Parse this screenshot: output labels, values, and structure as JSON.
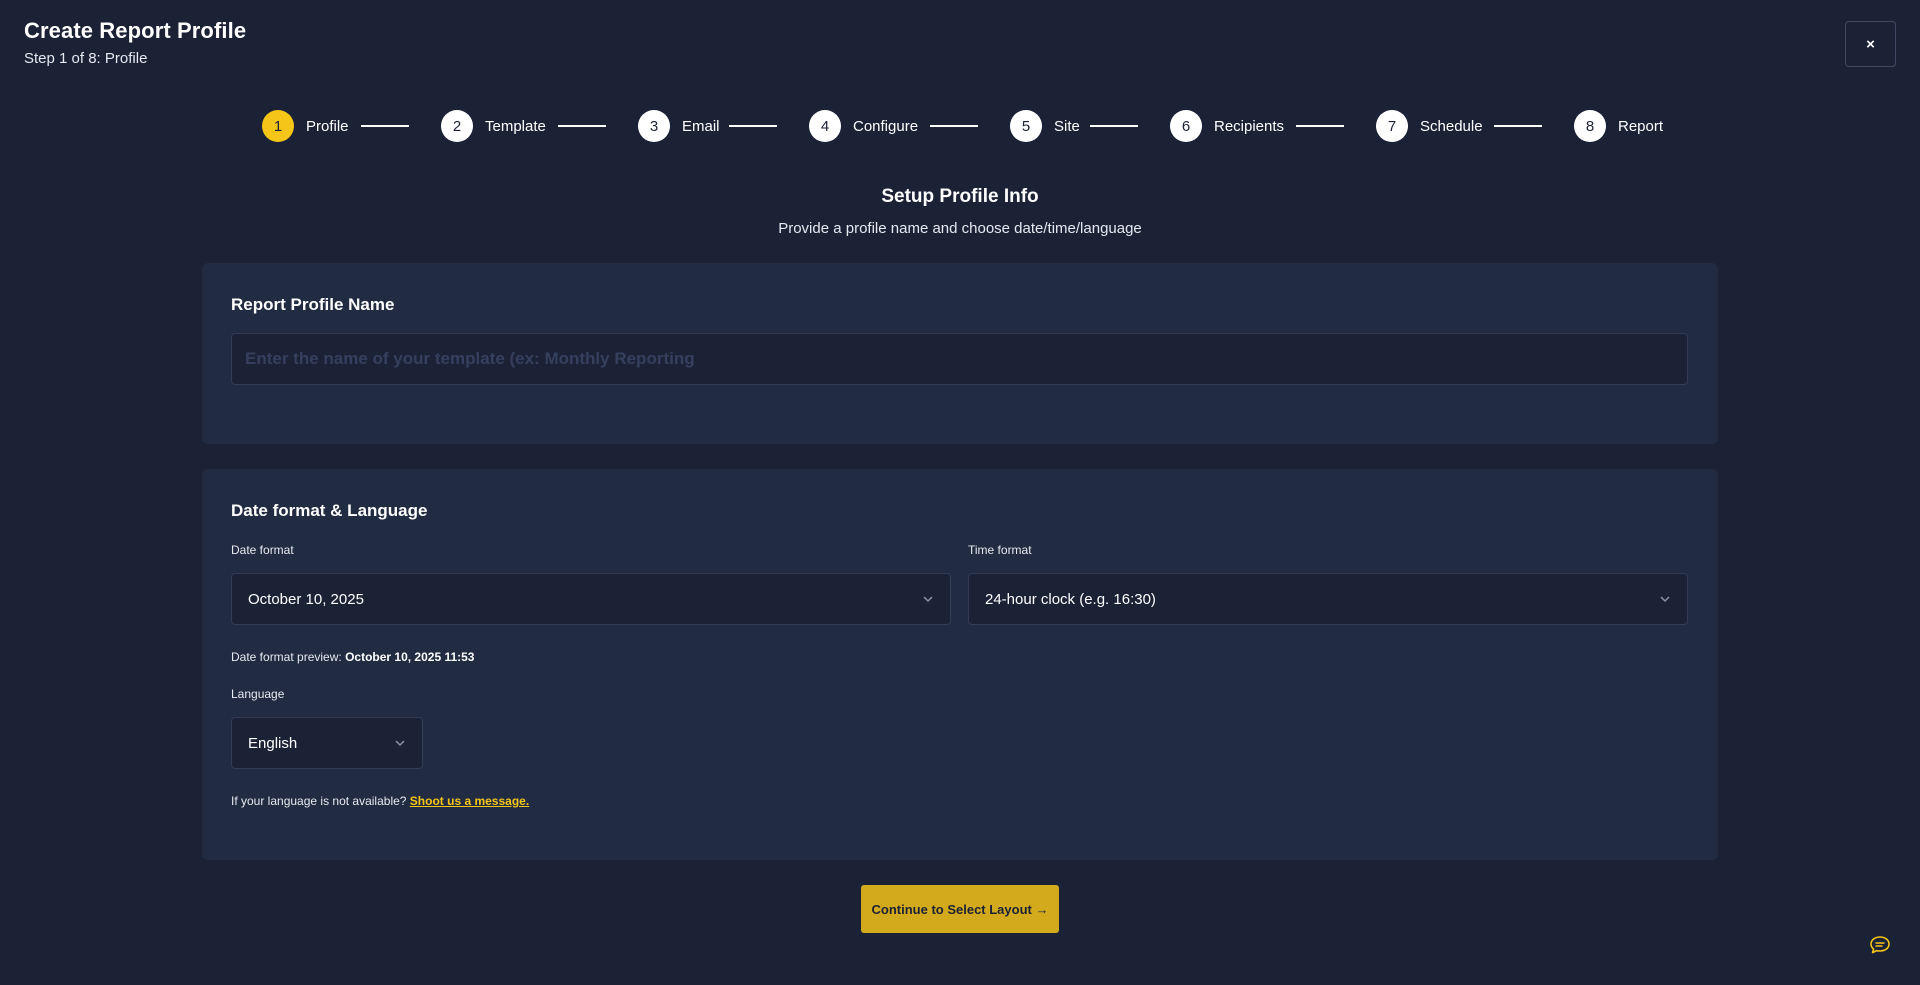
{
  "header": {
    "title": "Create Report Profile",
    "subtitle": "Step 1 of 8: Profile",
    "close_label": "×"
  },
  "stepper": {
    "steps": [
      {
        "number": "1",
        "label": "Profile",
        "active": true
      },
      {
        "number": "2",
        "label": "Template",
        "active": false
      },
      {
        "number": "3",
        "label": "Email",
        "active": false
      },
      {
        "number": "4",
        "label": "Configure",
        "active": false
      },
      {
        "number": "5",
        "label": "Site",
        "active": false
      },
      {
        "number": "6",
        "label": "Recipients",
        "active": false
      },
      {
        "number": "7",
        "label": "Schedule",
        "active": false
      },
      {
        "number": "8",
        "label": "Report",
        "active": false
      }
    ]
  },
  "section": {
    "title": "Setup Profile Info",
    "description": "Provide a profile name and choose date/time/language"
  },
  "profile_card": {
    "heading": "Report Profile Name",
    "input_value": "",
    "input_placeholder": "Enter the name of your template (ex: Monthly Reporting"
  },
  "date_card": {
    "heading": "Date format & Language",
    "date_format_label": "Date format",
    "date_format_value": "October 10, 2025",
    "time_format_label": "Time format",
    "time_format_value": "24-hour clock (e.g. 16:30)",
    "preview_label": "Date format preview:",
    "preview_value": "October 10, 2025 11:53",
    "language_label": "Language",
    "language_value": "English",
    "language_note": "If your language is not available?",
    "language_link": "Shoot us a message."
  },
  "footer": {
    "continue_label": "Continue to Select Layout →"
  },
  "colors": {
    "background": "#1b2236",
    "card": "#212b42",
    "accent": "#f5c518",
    "button": "#d3aa1c"
  },
  "icons": {
    "close": "close-icon",
    "chevron": "chevron-down-icon",
    "chat": "chat-icon"
  }
}
